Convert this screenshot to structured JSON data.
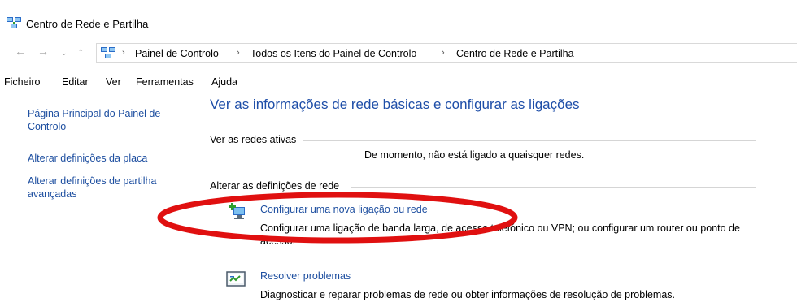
{
  "window": {
    "title": "Centro de Rede e Partilha",
    "title_icon": "network-center-icon"
  },
  "nav": {
    "back_icon": "back-arrow-icon",
    "forward_icon": "forward-arrow-icon",
    "up_icon": "up-arrow-icon",
    "breadcrumb": [
      "Painel de Controlo",
      "Todos os Itens do Painel de Controlo",
      "Centro de Rede e Partilha"
    ]
  },
  "menu": [
    "Ficheiro",
    "Editar",
    "Ver",
    "Ferramentas",
    "Ajuda"
  ],
  "sidebar": {
    "items": [
      {
        "label": "Página Principal do Painel de Controlo"
      },
      {
        "label": "Alterar definições da placa"
      },
      {
        "label": "Alterar definições de partilha avançadas"
      }
    ]
  },
  "main": {
    "heading": "Ver as informações de rede básicas e configurar as ligações",
    "active_networks_label": "Ver as redes ativas",
    "no_connection_text": "De momento, não está ligado a quaisquer redes.",
    "change_settings_label": "Alterar as definições de rede",
    "tasks": [
      {
        "icon": "new-connection-icon",
        "link": "Configurar uma nova ligação ou rede",
        "desc": "Configurar uma ligação de banda larga, de acesso telefónico ou VPN; ou configurar um router ou ponto de acesso."
      },
      {
        "icon": "troubleshoot-icon",
        "link": "Resolver problemas",
        "desc": "Diagnosticar e reparar problemas de rede ou obter informações de resolução de problemas."
      }
    ]
  },
  "annotation": {
    "color": "#e01010"
  },
  "colors": {
    "link": "#1e4fa0",
    "heading": "#1e4ea8"
  }
}
